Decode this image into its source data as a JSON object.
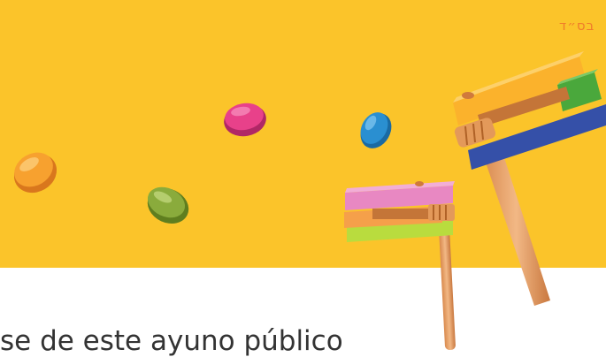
{
  "header": {
    "bsd": "בס״ד"
  },
  "body": {
    "caption": "se de este ayuno público"
  },
  "colors": {
    "hero_bg": "#fbc42a",
    "candy_orange": "#f7a12f",
    "candy_pink": "#e8418a",
    "candy_blue": "#2a8fd1",
    "candy_green": "#8aab3c",
    "grogger_wood": "#e9a56c"
  },
  "illustration": {
    "items": [
      "candy-orange",
      "candy-green",
      "candy-pink",
      "candy-blue",
      "grogger-small",
      "grogger-large"
    ]
  }
}
